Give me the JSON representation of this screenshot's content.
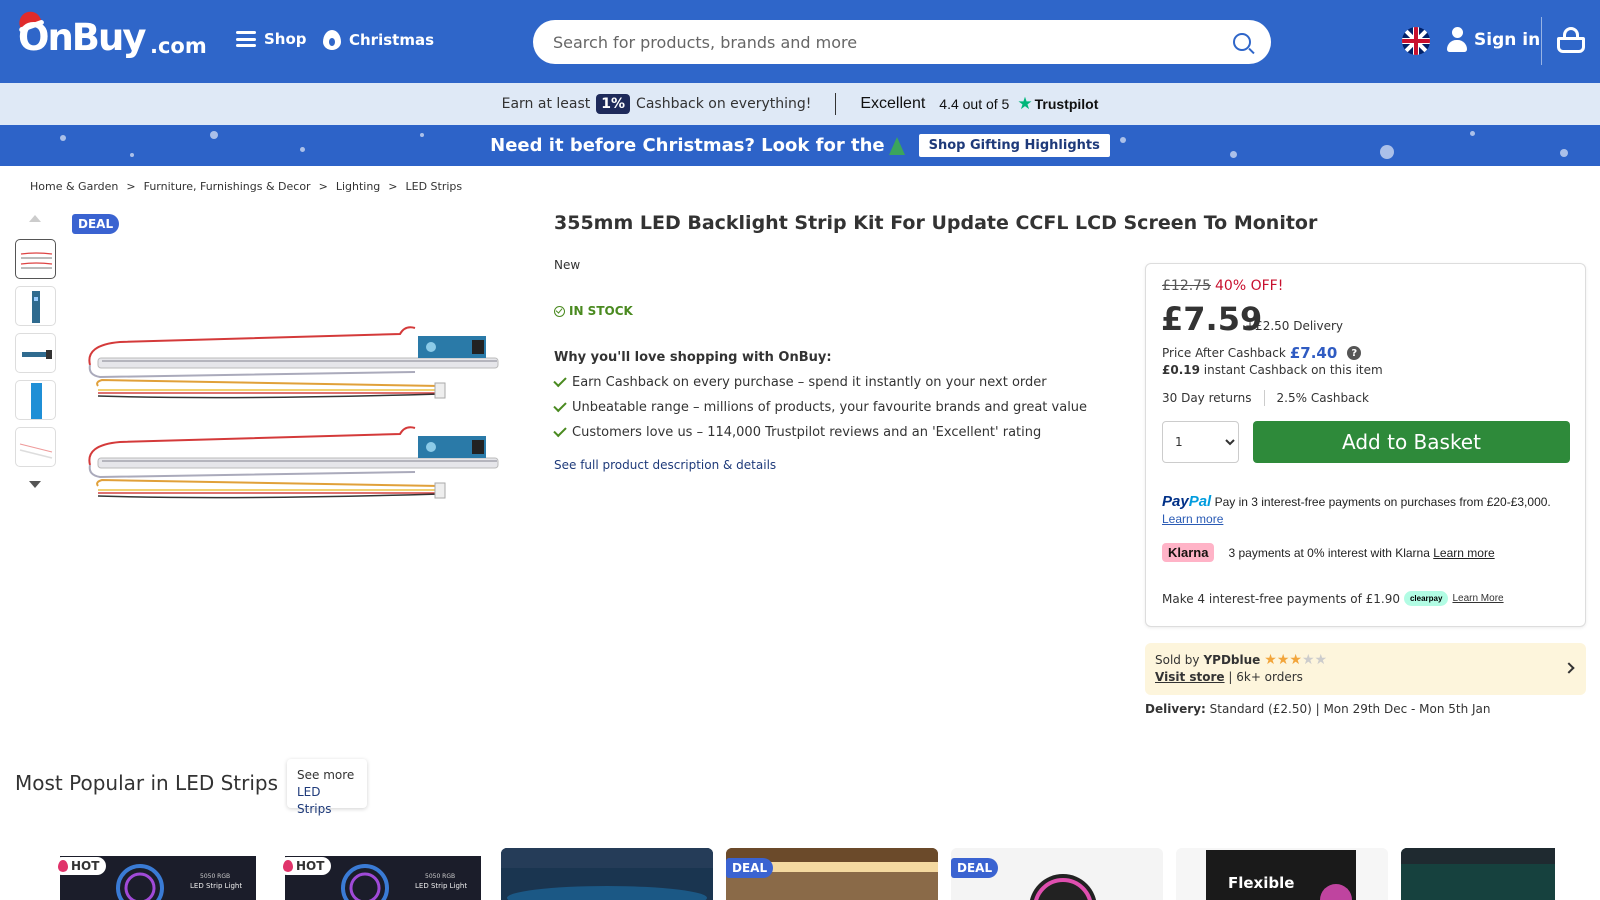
{
  "header": {
    "logo_text": "OnBuy",
    "logo_suffix": ".com",
    "nav_shop": "Shop",
    "nav_christmas": "Christmas",
    "search_placeholder": "Search for products, brands and more",
    "sign_in": "Sign in"
  },
  "cashback_bar": {
    "prefix": "Earn at least",
    "percent": "1%",
    "suffix": "Cashback on everything!",
    "trustpilot_rating_word": "Excellent",
    "trustpilot_score": "4.4 out of 5",
    "trustpilot_brand": "Trustpilot"
  },
  "christmas_banner": {
    "message": "Need it before Christmas? Look for the",
    "button": "Shop Gifting Highlights"
  },
  "breadcrumb": [
    "Home & Garden",
    "Furniture, Furnishings & Decor",
    "Lighting",
    "LED Strips"
  ],
  "gallery": {
    "deal_badge": "DEAL",
    "thumbnail_count": 5,
    "active_index": 0
  },
  "product": {
    "title": "355mm LED Backlight Strip Kit For Update CCFL LCD Screen To Monitor",
    "condition": "New",
    "stock": "IN STOCK",
    "why_heading": "Why you'll love shopping with OnBuy:",
    "benefits": [
      "Earn Cashback on every purchase – spend it instantly on your next order",
      "Unbeatable range – millions of products, your favourite brands and great value",
      "Customers love us – 114,000 Trustpilot reviews and an 'Excellent' rating"
    ],
    "see_full": "See full product description & details"
  },
  "buybox": {
    "was_price": "£12.75",
    "discount": "40% OFF!",
    "price": "£7.59",
    "delivery_fee": "+£2.50 Delivery",
    "price_after_cashback_label": "Price After Cashback",
    "price_after_cashback": "£7.40",
    "instant_cashback_amount": "£0.19",
    "instant_cashback_text": "instant Cashback on this item",
    "returns": "30 Day returns",
    "cashback_rate": "2.5% Cashback",
    "quantity": "1",
    "add_button": "Add to Basket",
    "paypal_logo_a": "Pay",
    "paypal_logo_b": "Pal",
    "paypal_text": "Pay in 3 interest-free payments on purchases from £20-£3,000.",
    "paypal_learn": "Learn more",
    "klarna_logo": "Klarna",
    "klarna_text": "3 payments at 0% interest with Klarna",
    "klarna_learn": "Learn more",
    "clearpay_text": "Make 4 interest-free payments of £1.90",
    "clearpay_logo": "clearpay",
    "clearpay_learn": "Learn More"
  },
  "seller": {
    "sold_by": "Sold by",
    "name": "YPDblue",
    "rating": 3,
    "rating_max": 5,
    "visit_store": "Visit store",
    "orders": "| 6k+ orders"
  },
  "delivery": {
    "label": "Delivery:",
    "text": "Standard (£2.50) | Mon 29th Dec - Mon 5th Jan"
  },
  "popular": {
    "title": "Most Popular in LED Strips",
    "see_more": "See more",
    "see_more_link": "LED Strips",
    "cards": [
      {
        "badge": "HOT",
        "bg": "#1b1d2a"
      },
      {
        "badge": "HOT",
        "bg": "#1b1d2a"
      },
      {
        "badge": "",
        "bg": "#1a3550"
      },
      {
        "badge": "DEAL",
        "bg": "#6b4a2a"
      },
      {
        "badge": "DEAL",
        "bg": "#f4f4f4"
      },
      {
        "badge": "",
        "bg": "#f6f6f6"
      },
      {
        "badge": "",
        "bg": "#16413e"
      }
    ]
  },
  "colors": {
    "header_blue": "#2f66c9",
    "cashbar_bg": "#dfe9f6",
    "add_button": "#2e8a3a",
    "discount_red": "#c8102e",
    "in_stock_green": "#4a8a20",
    "deal_badge": "#3a63d1"
  }
}
